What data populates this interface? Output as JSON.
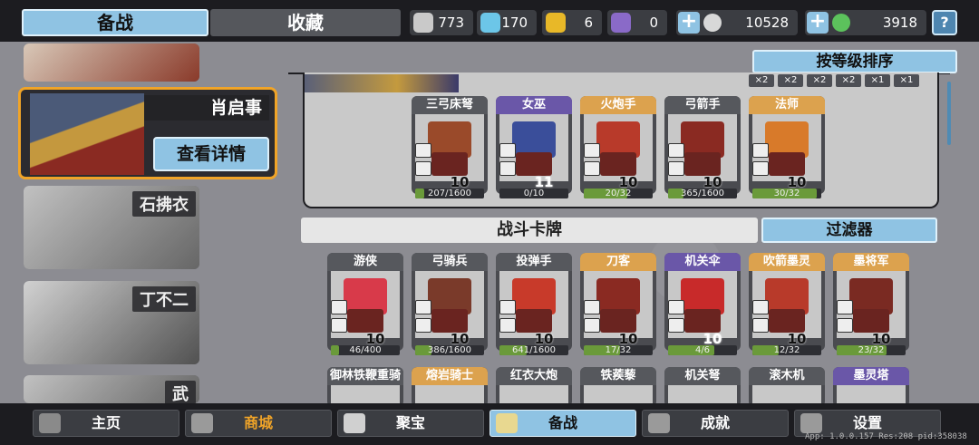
{
  "tabs": {
    "prepare": "备战",
    "collect": "收藏"
  },
  "resources": [
    {
      "icon": "silver-trophy-icon",
      "value": "773",
      "color": "#c9c9c9"
    },
    {
      "icon": "crystal-trophy-icon",
      "value": "170",
      "color": "#6cc6e8"
    },
    {
      "icon": "gold-trophy-icon",
      "value": "6",
      "color": "#e8b828"
    },
    {
      "icon": "purple-trophy-icon",
      "value": "0",
      "color": "#8a6ac8"
    }
  ],
  "currency": [
    {
      "icon": "silver-coin-icon",
      "value": "10528",
      "color": "#d8d8d8"
    },
    {
      "icon": "jade-coin-icon",
      "value": "3918",
      "color": "#5cc25c"
    }
  ],
  "help": "?",
  "sort_label": "按等级排序",
  "multipliers": [
    "×2",
    "×2",
    "×2",
    "×2",
    "×1",
    "×1"
  ],
  "heroes": {
    "selected": {
      "name": "肖启事",
      "detail": "查看详情"
    },
    "list": [
      "石拂衣",
      "丁不二",
      "武"
    ]
  },
  "deck": [
    {
      "name": "三弓床弩",
      "level": "10",
      "progress": "207/1600",
      "frame": "gray",
      "fill": 0.13,
      "head": "#9a4a2a"
    },
    {
      "name": "女巫",
      "level": "11",
      "progress": "0/10",
      "frame": "purple",
      "fill": 0,
      "head": "#3a4e9a"
    },
    {
      "name": "火炮手",
      "level": "10",
      "progress": "20/32",
      "frame": "orange",
      "fill": 0.63,
      "head": "#b83a2a"
    },
    {
      "name": "弓箭手",
      "level": "10",
      "progress": "365/1600",
      "frame": "gray",
      "fill": 0.23,
      "head": "#8a2a22"
    },
    {
      "name": "法师",
      "level": "10",
      "progress": "30/32",
      "frame": "orange",
      "fill": 0.94,
      "head": "#d87a2a"
    }
  ],
  "battle_title": "战斗卡牌",
  "filter_label": "过滤器",
  "battle_cards": [
    {
      "name": "游侠",
      "level": "10",
      "progress": "46/400",
      "frame": "gray",
      "fill": 0.12,
      "head": "#d83a4a"
    },
    {
      "name": "弓骑兵",
      "level": "10",
      "progress": "386/1600",
      "frame": "gray",
      "fill": 0.24,
      "head": "#7a3a2a"
    },
    {
      "name": "投弹手",
      "level": "10",
      "progress": "641/1600",
      "frame": "gray",
      "fill": 0.4,
      "head": "#c83a2a"
    },
    {
      "name": "刀客",
      "level": "10",
      "progress": "17/32",
      "frame": "orange",
      "fill": 0.53,
      "head": "#8a2a22"
    },
    {
      "name": "机关伞",
      "level": "10",
      "progress": "4/6",
      "frame": "purple",
      "fill": 0.67,
      "head": "#c82a2a"
    },
    {
      "name": "吹箭墨灵",
      "level": "10",
      "progress": "12/32",
      "frame": "orange",
      "fill": 0.38,
      "head": "#b83a2a"
    },
    {
      "name": "墨将军",
      "level": "10",
      "progress": "23/32",
      "frame": "orange",
      "fill": 0.72,
      "head": "#7a2a22"
    }
  ],
  "battle_cards_row2": [
    {
      "name": "御林铁鞭重骑兵",
      "frame": "gray"
    },
    {
      "name": "熔岩骑士",
      "frame": "orange"
    },
    {
      "name": "红衣大炮",
      "frame": "gray"
    },
    {
      "name": "铁蒺藜",
      "frame": "gray"
    },
    {
      "name": "机关弩",
      "frame": "gray"
    },
    {
      "name": "滚木机",
      "frame": "gray"
    },
    {
      "name": "墨灵塔",
      "frame": "purple"
    }
  ],
  "nav": [
    {
      "label": "主页",
      "icon": "home-icon"
    },
    {
      "label": "商城",
      "icon": "shop-icon"
    },
    {
      "label": "聚宝",
      "icon": "treasure-bowl-icon"
    },
    {
      "label": "备战",
      "icon": "cards-icon"
    },
    {
      "label": "成就",
      "icon": "achievement-icon"
    },
    {
      "label": "设置",
      "icon": "gear-icon"
    }
  ],
  "version": "App: 1.0.0.157 Res:208 pid:358038"
}
